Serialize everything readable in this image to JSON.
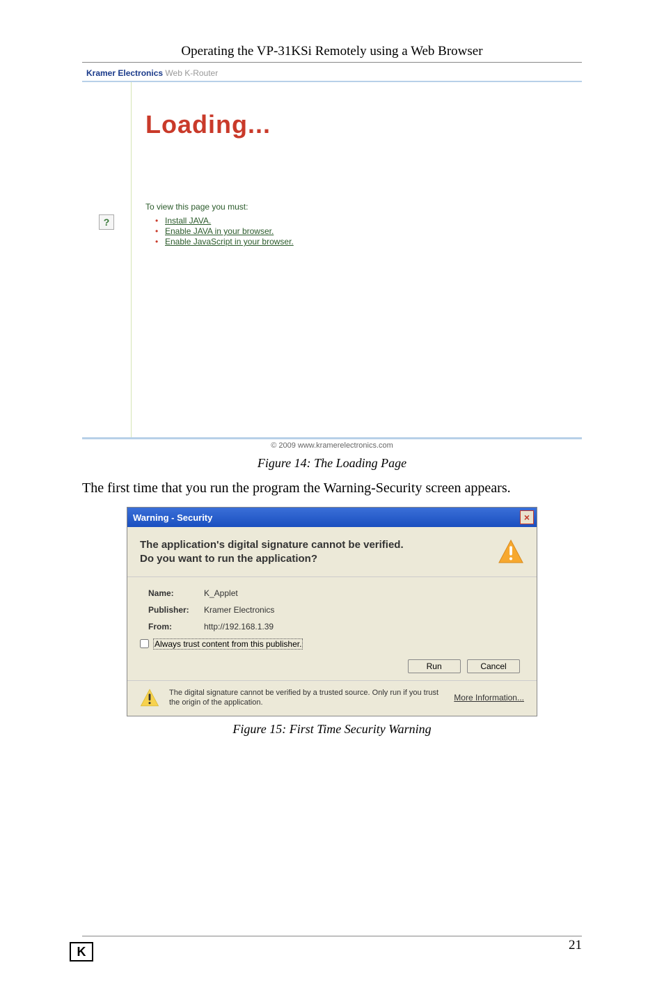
{
  "header": {
    "title": "Operating the VP-31KSi Remotely using a Web Browser"
  },
  "browser": {
    "brand": "Kramer Electronics",
    "sub": "Web K-Router",
    "help_glyph": "?",
    "loading": "Loading...",
    "instructions_intro": "To view this page you must:",
    "links": {
      "install": "Install JAVA.",
      "enable_java": "Enable JAVA in your browser.",
      "enable_js": "Enable JavaScript in your browser."
    },
    "footer": "© 2009 www.kramerelectronics.com"
  },
  "captions": {
    "fig14": "Figure 14: The Loading Page",
    "fig15": "Figure 15: First Time Security Warning"
  },
  "body_text": "The first time that you run the program the Warning-Security screen appears.",
  "dialog": {
    "title": "Warning - Security",
    "close_glyph": "×",
    "question_l1": "The application's digital signature cannot be verified.",
    "question_l2": "Do you want to run the application?",
    "labels": {
      "name": "Name:",
      "publisher": "Publisher:",
      "from": "From:"
    },
    "values": {
      "name": "K_Applet",
      "publisher": "Kramer Electronics",
      "from": "http://192.168.1.39"
    },
    "checkbox_label": "Always trust content from this publisher.",
    "buttons": {
      "run": "Run",
      "cancel": "Cancel"
    },
    "footnote": "The digital signature cannot be verified by a trusted source.  Only run if you trust the origin of the application.",
    "more_info": "More Information..."
  },
  "page": {
    "number": "21",
    "logo": "K"
  }
}
